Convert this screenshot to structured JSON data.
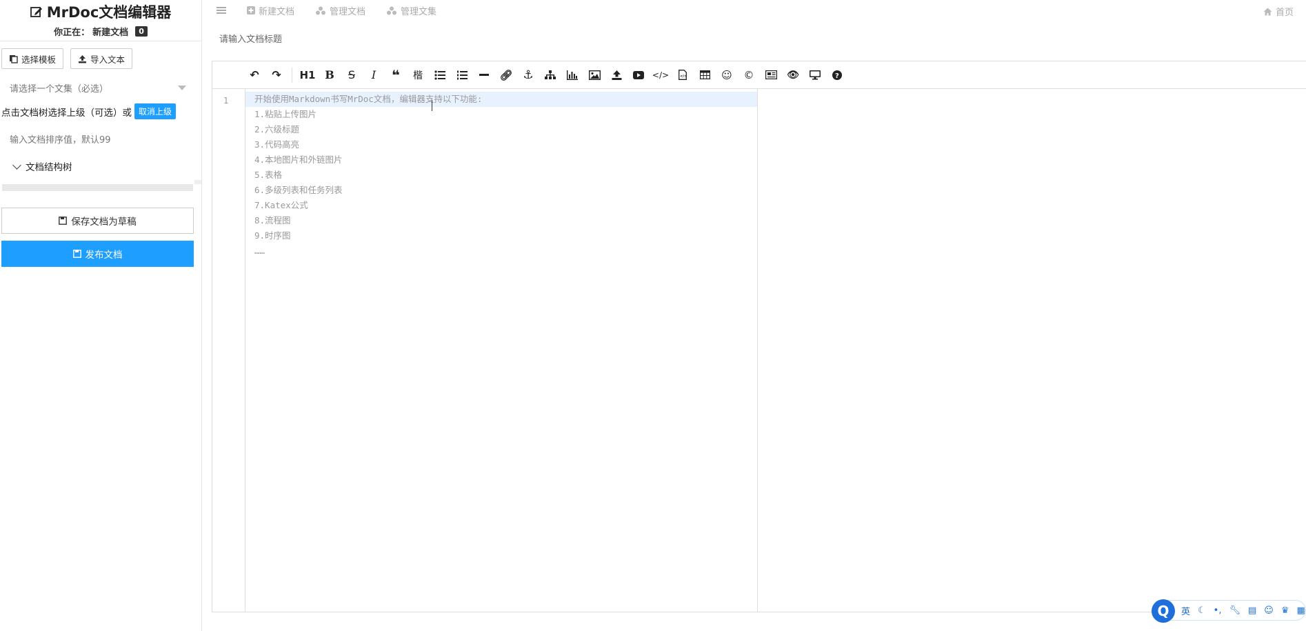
{
  "sidebar": {
    "title": "MrDoc文档编辑器",
    "sub_label": "你正在：",
    "sub_value": "新建文档",
    "badge": "0",
    "template_button": "选择模板",
    "import_button": "导入文本",
    "collection_placeholder": "请选择一个文集（必选）",
    "parent_text": "点击文档树选择上级（可选）或",
    "cancel_parent": "取消上级",
    "sort_placeholder": "输入文档排序值，默认99",
    "tree_label": "文档结构树",
    "save_draft": "保存文档为草稿",
    "publish": "发布文档"
  },
  "topnav": {
    "new_doc": "新建文档",
    "manage_doc": "管理文档",
    "manage_collection": "管理文集",
    "home": "首页"
  },
  "title_placeholder": "请输入文档标题",
  "editor": {
    "line_number": "1",
    "lines": [
      "开始使用Markdown书写MrDoc文档，编辑器支持以下功能:",
      "1.粘贴上传图片",
      "2.六级标题",
      "3.代码高亮",
      "4.本地图片和外链图片",
      "5.表格",
      "6.多级列表和任务列表",
      "7.Katex公式",
      "8.流程图",
      "9.时序图",
      "……"
    ],
    "toolbar_h1": "H1",
    "toolbar_kai": "楷"
  },
  "float_widget": {
    "logo": "Q",
    "lang": "英"
  }
}
